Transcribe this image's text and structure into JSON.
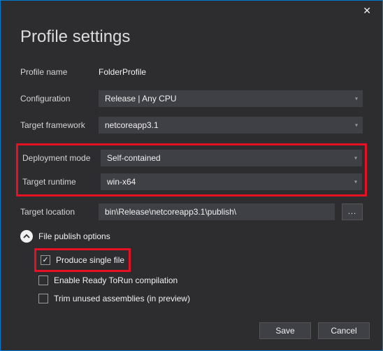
{
  "title": "Profile settings",
  "labels": {
    "profile_name": "Profile name",
    "configuration": "Configuration",
    "target_framework": "Target framework",
    "deployment_mode": "Deployment mode",
    "target_runtime": "Target runtime",
    "target_location": "Target location"
  },
  "values": {
    "profile_name": "FolderProfile",
    "configuration": "Release | Any CPU",
    "target_framework": "netcoreapp3.1",
    "deployment_mode": "Self-contained",
    "target_runtime": "win-x64",
    "target_location": "bin\\Release\\netcoreapp3.1\\publish\\"
  },
  "browse_label": "...",
  "expander": {
    "label": "File publish options"
  },
  "checks": {
    "single_file": "Produce single file",
    "ready_to_run": "Enable Ready ToRun compilation",
    "trim": "Trim unused assemblies (in preview)"
  },
  "buttons": {
    "save": "Save",
    "cancel": "Cancel"
  }
}
